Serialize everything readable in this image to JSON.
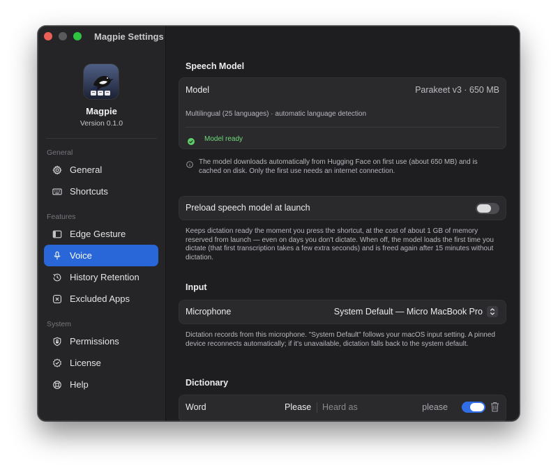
{
  "window": {
    "title": "Magpie Settings"
  },
  "app": {
    "name": "Magpie",
    "version": "Version 0.1.0"
  },
  "sidebar": {
    "groups": [
      {
        "label": "General"
      },
      {
        "label": "Features"
      },
      {
        "label": "System"
      }
    ],
    "items": [
      {
        "label": "General",
        "icon": "gear-icon"
      },
      {
        "label": "Shortcuts",
        "icon": "keyboard-icon"
      },
      {
        "label": "Edge Gesture",
        "icon": "sidebar-panel-icon"
      },
      {
        "label": "Voice",
        "icon": "microphone-icon",
        "active": true
      },
      {
        "label": "History Retention",
        "icon": "clock-history-icon"
      },
      {
        "label": "Excluded Apps",
        "icon": "x-square-icon"
      },
      {
        "label": "Permissions",
        "icon": "lock-shield-icon"
      },
      {
        "label": "License",
        "icon": "checkmark-seal-icon"
      },
      {
        "label": "Help",
        "icon": "lifebuoy-icon"
      }
    ]
  },
  "speech_model": {
    "title": "Speech Model",
    "model_label": "Model",
    "model_value": "Parakeet v3 · 650 MB",
    "description": "Multilingual (25 languages) · automatic language detection",
    "status": "Model ready",
    "note": "The model downloads automatically from Hugging Face on first use (about 650 MB) and is cached on disk. Only the first use needs an internet connection."
  },
  "preload": {
    "label": "Preload speech model at launch",
    "enabled": false,
    "note": "Keeps dictation ready the moment you press the shortcut, at the cost of about 1 GB of memory reserved from launch — even on days you don't dictate. When off, the model loads the first time you dictate (that first transcription takes a few extra seconds) and is freed again after 15 minutes without dictation."
  },
  "input": {
    "title": "Input",
    "microphone_label": "Microphone",
    "microphone_value": "System Default — Micro MacBook Pro",
    "note": "Dictation records from this microphone. \"System Default\" follows your macOS input setting. A pinned device reconnects automatically; if it's unavailable, dictation falls back to the system default."
  },
  "dictionary": {
    "title": "Dictionary",
    "row": {
      "label": "Word",
      "word": "Please",
      "heard_placeholder": "Heard as",
      "heard_value": "please",
      "enabled": true
    }
  },
  "colors": {
    "accent": "#2966d8",
    "toggle_on": "#2f6ee6",
    "status_green": "#5fcf6b",
    "window_bg": "#1e1e21",
    "sidebar_bg": "#252528"
  }
}
